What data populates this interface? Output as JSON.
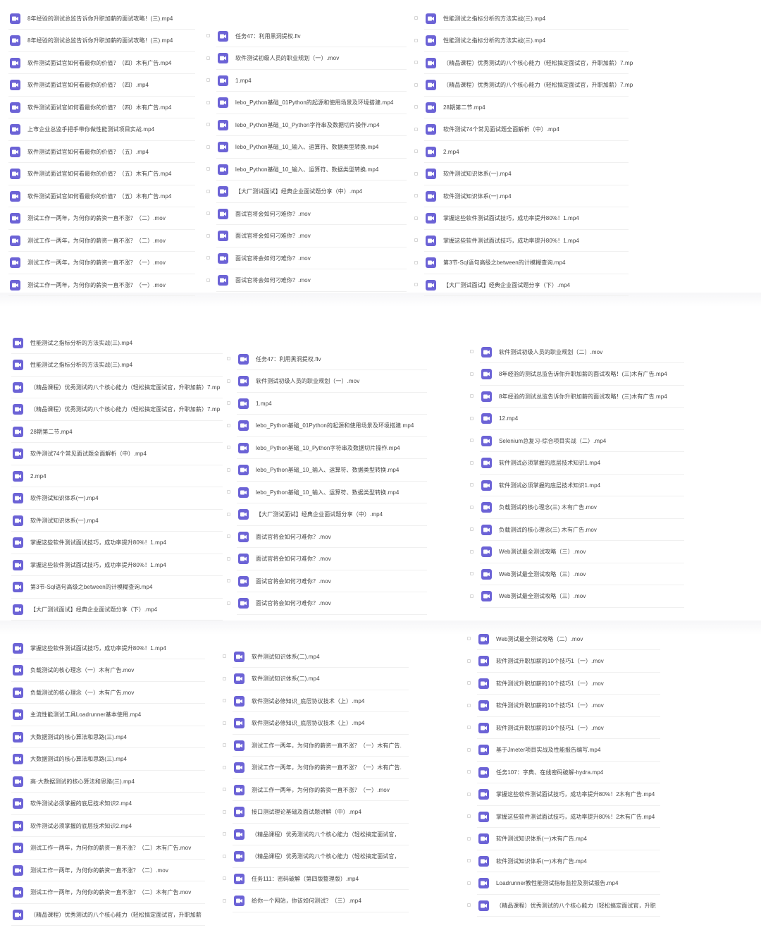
{
  "panels": [
    {
      "name": "panel-1",
      "columns": [
        {
          "items": [
            "8年经验的测试总监告诉你升职加薪的面试攻略！(三).mp4",
            "8年经验的测试总监告诉你升职加薪的面试攻略！(三).mp4",
            "软件测试面试官如何看最你的价值？（四）木有广告.mp4",
            "软件测试面试官如何看最你的价值？（四）.mp4",
            "软件测试面试官如何看最你的价值？（四）木有广告.mp4",
            "上市企业总监手把手带你做性能测试项目实战.mp4",
            "软件测试面试官如何看最你的价值？（五）.mp4",
            "软件测试面试官如何看最你的价值？（五）木有广告.mp4",
            "软件测试面试官如何看最你的价值？（五）木有广告.mp4",
            "测试工作一两年，为何你的薪资一直不涨？（二）.mov",
            "测试工作一两年，为何你的薪资一直不涨？（二）.mov",
            "测试工作一两年，为何你的薪资一直不涨？（一）.mov",
            "测试工作一两年，为何你的薪资一直不涨？（一）.mov"
          ]
        },
        {
          "items": [
            "任务47：利用黑洞提权.flv",
            "软件测试初级人员的职业规划（一）.mov",
            "1.mp4",
            "lebo_Python基础_01Python的起源和使用场景及环境搭建.mp4",
            "lebo_Python基础_10_Python字符串及数据切片操作.mp4",
            "lebo_Python基础_10_输入、运算符、数据类型转换.mp4",
            "lebo_Python基础_10_输入、运算符、数据类型转换.mp4",
            "【大厂测试面试】经典企业面试题分享（中）.mp4",
            "面试官将会如何刁难你？.mov",
            "面试官将会如何刁难你？.mov",
            "面试官将会如何刁难你？.mov",
            "面试官将会如何刁难你？.mov"
          ]
        },
        {
          "items": [
            "性能测试之指标分析的方法实战(三).mp4",
            "性能测试之指标分析的方法实战(三).mp4",
            "（精品课程）优秀测试的八个核心能力（轻松搞定面试官，升职加薪）7.mp",
            "（精品课程）优秀测试的八个核心能力（轻松搞定面试官，升职加薪）7.mp",
            "28期第二节.mp4",
            "软件测试74个常见面试题全面解析（中）.mp4",
            "2.mp4",
            "软件测试知识体系(一).mp4",
            "软件测试知识体系(一).mp4",
            "掌握这些软件测试面试技巧，成功率提升80%！1.mp4",
            "掌握这些软件测试面试技巧，成功率提升80%！1.mp4",
            "第3节-Sql语句高级之between的计模糊查询.mp4",
            "【大厂测试面试】经典企业面试题分享（下）.mp4"
          ]
        }
      ]
    },
    {
      "name": "panel-2",
      "columns": [
        {
          "items": [
            "性能测试之指标分析的方法实战(三).mp4",
            "性能测试之指标分析的方法实战(三).mp4",
            "（精品课程）优秀测试的八个核心能力（轻松搞定面试官，升职加薪）7.mp",
            "（精品课程）优秀测试的八个核心能力（轻松搞定面试官，升职加薪）7.mp",
            "28期第二节.mp4",
            "软件测试74个常见面试题全面解析（中）.mp4",
            "2.mp4",
            "软件测试知识体系(一).mp4",
            "软件测试知识体系(一).mp4",
            "掌握这些软件测试面试技巧，成功率提升80%！1.mp4",
            "掌握这些软件测试面试技巧，成功率提升80%！1.mp4",
            "第3节-Sql语句高级之between的计模糊查询.mp4",
            "【大厂测试面试】经典企业面试题分享（下）.mp4"
          ]
        },
        {
          "items": [
            "任务47：利用黑洞提权.flv",
            "软件测试初级人员的职业规划（一）.mov",
            "1.mp4",
            "lebo_Python基础_01Python的起源和使用场景及环境搭建.mp4",
            "lebo_Python基础_10_Python字符串及数据切片操作.mp4",
            "lebo_Python基础_10_输入、运算符、数据类型转换.mp4",
            "lebo_Python基础_10_输入、运算符、数据类型转换.mp4",
            "【大厂测试面试】经典企业面试题分享（中）.mp4",
            "面试官将会如何刁难你？.mov",
            "面试官将会如何刁难你？.mov",
            "面试官将会如何刁难你？.mov",
            "面试官将会如何刁难你？.mov"
          ]
        },
        {
          "items": [
            "软件测试初级人员的职业规划（二）.mov",
            "8年经验的测试总监告诉你升职加薪的面试攻略！(三)木有广告.mp4",
            "8年经验的测试总监告诉你升职加薪的面试攻略！(三)木有广告.mp4",
            "12.mp4",
            "Selenium总复习-综合项目实战（二）.mp4",
            "软件测试必须掌握的底层技术知识1.mp4",
            "软件测试必须掌握的底层技术知识1.mp4",
            "负载测试的核心理念(三) 木有广告.mov",
            "负载测试的核心理念(三) 木有广告.mov",
            "Web测试最全测试攻略（三）.mov",
            "Web测试最全测试攻略（三）.mov",
            "Web测试最全测试攻略（三）.mov"
          ]
        }
      ]
    },
    {
      "name": "panel-3",
      "columns": [
        {
          "items": [
            "掌握这些软件测试面试技巧，成功率提升80%！1.mp4",
            "负载测试的核心理念（一）木有广告.mov",
            "负载测试的核心理念（一）木有广告.mov",
            "主流性能测试工具Loadrunner基本使用.mp4",
            "大数据测试的核心算法和思路(三).mp4",
            "大数据测试的核心算法和思路(三).mp4",
            "高·大数据测试的核心算法和思路(三).mp4",
            "软件测试必须掌握的底层技术知识2.mp4",
            "软件测试必须掌握的底层技术知识2.mp4",
            "测试工作一两年，为何你的薪资一直不涨？（二）木有广告.mov",
            "测试工作一两年，为何你的薪资一直不涨？（二）.mov",
            "测试工作一两年，为何你的薪资一直不涨？（二）木有广告.mov",
            "（精品课程）优秀测试的八个核心能力（轻松搞定面试官，升职加薪"
          ]
        },
        {
          "items": [
            "软件测试知识体系(二).mp4",
            "软件测试知识体系(二).mp4",
            "软件测试必修知识_底层协议技术（上）.mp4",
            "软件测试必修知识_底层协议技术（上）.mp4",
            "测试工作一两年，为何你的薪资一直不涨？（一）木有广告.",
            "测试工作一两年，为何你的薪资一直不涨？（一）木有广告.",
            "测试工作一两年，为何你的薪资一直不涨？（一）.mov",
            "接口测试理论基础及面试题讲解（中）.mp4",
            "（精品课程）优秀测试的八个核心能力（轻松搞定面试官，",
            "（精品课程）优秀测试的八个核心能力（轻松搞定面试官，",
            "任务111：密码破解（第四版整理版）.mp4",
            "给你一个网站，你该如何测试？（三）.mp4"
          ]
        },
        {
          "items": [
            "Web测试最全测试攻略（二）.mov",
            "软件测试升职加薪的10个技巧1（一）.mov",
            "软件测试升职加薪的10个技巧1（一）.mov",
            "软件测试升职加薪的10个技巧1（一）.mov",
            "软件测试升职加薪的10个技巧1（一）.mov",
            "基于Jmeter项目实战及性能报告编写.mp4",
            "任务107：字典、在线密码破解-hydra.mp4",
            "掌握这些软件测试面试技巧，成功率提升80%！2木有广告.mp4",
            "掌握这些软件测试面试技巧，成功率提升80%！2木有广告.mp4",
            "软件测试知识体系(一)木有广告.mp4",
            "软件测试知识体系(一)木有广告.mp4",
            "Loadrunner教性能测试指标监控及测试报告.mp4",
            "（精品课程）优秀测试的八个核心能力（轻松搞定面试官，升职"
          ]
        }
      ]
    }
  ]
}
